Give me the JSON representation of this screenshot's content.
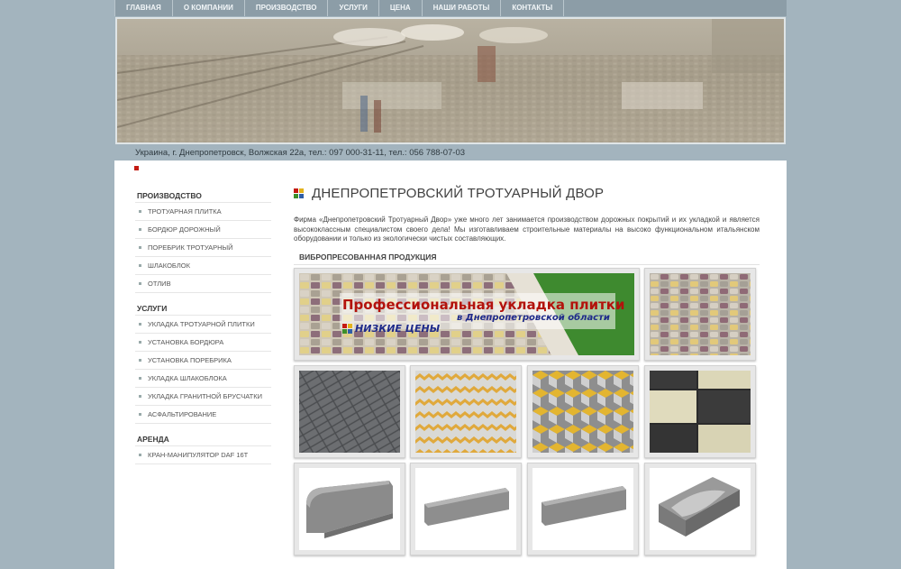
{
  "nav": {
    "items": [
      "ГЛАВНАЯ",
      "О КОМПАНИИ",
      "ПРОИЗВОДСТВО",
      "УСЛУГИ",
      "ЦЕНА",
      "НАШИ РАБОТЫ",
      "КОНТАКТЫ"
    ]
  },
  "header": {
    "address": "Украина, г. Днепропетровск, Волжская 22а, тел.: 097 000-31-11, тел.: 056 788-07-03"
  },
  "sidebar": {
    "sections": [
      {
        "title": "ПРОИЗВОДСТВО",
        "items": [
          "ТРОТУАРНАЯ ПЛИТКА",
          "БОРДЮР ДОРОЖНЫЙ",
          "ПОРЕБРИК ТРОТУАРНЫЙ",
          "ШЛАКОБЛОК",
          "ОТЛИВ"
        ]
      },
      {
        "title": "УСЛУГИ",
        "items": [
          "УКЛАДКА ТРОТУАРНОЙ ПЛИТКИ",
          "УСТАНОВКА БОРДЮРА",
          "УСТАНОВКА ПОРЕБРИКА",
          "УКЛАДКА ШЛАКОБЛОКА",
          "УКЛАДКА ГРАНИТНОЙ БРУСЧАТКИ",
          "АСФАЛЬТИРОВАНИЕ"
        ]
      },
      {
        "title": "АРЕНДА",
        "items": [
          "КРАН-МАНИПУЛЯТОР DAF 16T"
        ]
      }
    ]
  },
  "main": {
    "title": "ДНЕПРОПЕТРОВСКИЙ ТРОТУАРНЫЙ ДВОР",
    "intro": "Фирма «Днепропетровский Тротуарный Двор» уже много лет занимается производством дорожных покрытий и их укладкой и является высококлассным специалистом своего дела! Мы изготавливаем строительные материалы на высоко функциональном итальянском оборудовании и только из экологически чистых составляющих.",
    "section_label": "ВИБРОПРЕСОВАННАЯ ПРОДУКЦИЯ",
    "promo": {
      "headline": "Профессиональная укладка плитки",
      "subline": "в Днепропетровской области",
      "badge": "НИЗКИЕ ЦЕНЫ"
    }
  },
  "colors": {
    "background": "#a3b4be",
    "nav": "#8c9da7",
    "accent_red": "#c41a12",
    "promo_red": "#b3120c",
    "promo_blue": "#1e2a8a"
  }
}
